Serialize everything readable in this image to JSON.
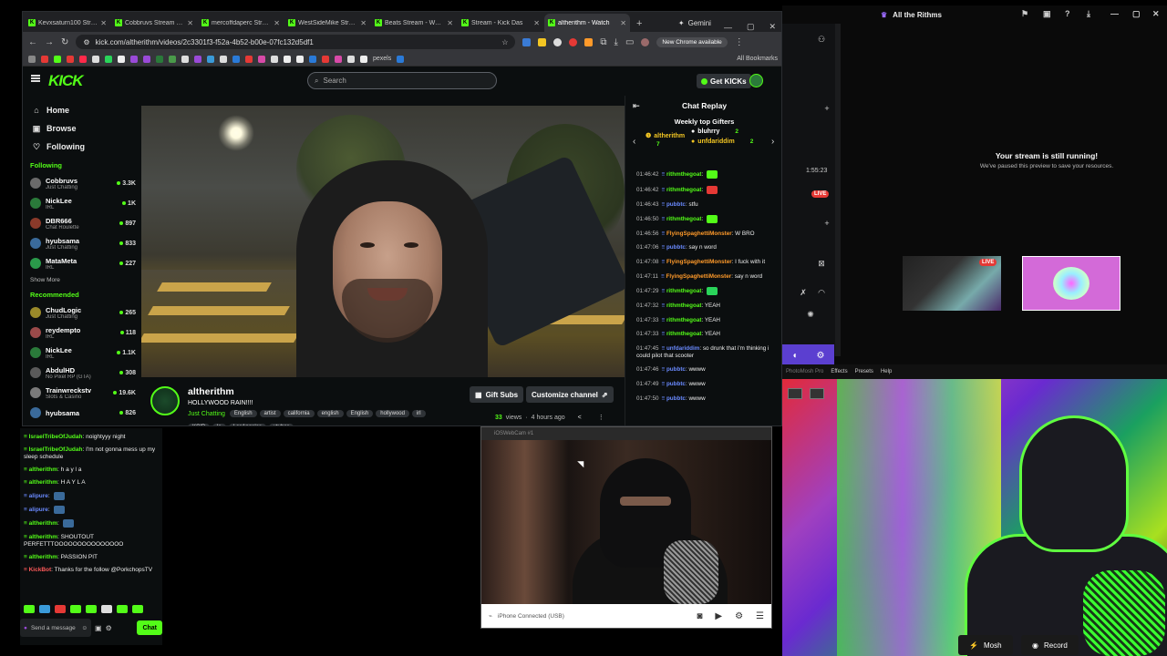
{
  "browser": {
    "tabs": [
      {
        "label": "Kevxsaturn100 Stream",
        "active": false
      },
      {
        "label": "Cobbruvs Stream - W",
        "active": false
      },
      {
        "label": "mercoffdaperc Stream",
        "active": false
      },
      {
        "label": "WestSideMike Stream",
        "active": false
      },
      {
        "label": "Beats Stream - Watch",
        "active": false
      },
      {
        "label": "Stream - Kick Das",
        "active": false
      },
      {
        "label": "altherithm - Watch",
        "active": true
      }
    ],
    "gemini_label": "Gemini",
    "url": "kick.com/altherithm/videos/2c3301f3-f52a-4b52-b00e-07fc132d5df1",
    "chrome_pill": "New Chrome available",
    "bookmark_pexels": "pexels",
    "all_bookmarks": "All Bookmarks"
  },
  "kick": {
    "logo": "KICK",
    "search_placeholder": "Search",
    "get_kicks": "Get KICKs",
    "nav": [
      {
        "label": "Home",
        "icon": "⌂"
      },
      {
        "label": "Browse",
        "icon": "▣"
      },
      {
        "label": "Following",
        "icon": "♡"
      }
    ],
    "following_heading": "Following",
    "following": [
      {
        "name": "Cobbruvs",
        "category": "Just Chatting",
        "viewers": "3.3K",
        "color": "#6a6a6a"
      },
      {
        "name": "NickLee",
        "category": "IRL",
        "viewers": "1K",
        "color": "#2a7a3a"
      },
      {
        "name": "DBR666",
        "category": "Chat Roulette",
        "viewers": "897",
        "color": "#8a3a2a"
      },
      {
        "name": "hyubsama",
        "category": "Just Chatting",
        "viewers": "833",
        "color": "#3a6a9a"
      },
      {
        "name": "MataMeta",
        "category": "IRL",
        "viewers": "227",
        "color": "#2a9a4a"
      }
    ],
    "show_more": "Show More",
    "recommended_heading": "Recommended",
    "recommended": [
      {
        "name": "ChudLogic",
        "category": "Just Chatting",
        "viewers": "265",
        "color": "#9a8a2a"
      },
      {
        "name": "reydempto",
        "category": "IRL",
        "viewers": "118",
        "color": "#9a4a4a"
      },
      {
        "name": "NickLee",
        "category": "IRL",
        "viewers": "1.1K",
        "color": "#2a7a3a"
      },
      {
        "name": "AbdulHD",
        "category": "No Pixel RP (GTA)",
        "viewers": "308",
        "color": "#5a5a5a"
      },
      {
        "name": "Trainwreckstv",
        "category": "Slots & Casino",
        "viewers": "19.6K",
        "color": "#7a7a7a"
      },
      {
        "name": "hyubsama",
        "category": "",
        "viewers": "826",
        "color": "#3a6a9a"
      }
    ],
    "stream": {
      "streamer": "altherithm",
      "title": "HOLLYWOOD RAIN!!!!",
      "category": "Just Chatting",
      "tags_row1": [
        "English",
        "artist",
        "california",
        "english",
        "English",
        "hollywood",
        "irl"
      ],
      "tags_row2": [
        "KCIP",
        "la",
        "LosAngeles",
        "vtuber"
      ],
      "gift_subs": "Gift Subs",
      "customize": "Customize channel",
      "views_count": "33",
      "views_label": "views",
      "time_ago": "4 hours ago"
    },
    "chat": {
      "title": "Chat Replay",
      "gifters_title": "Weekly top Gifters",
      "gifters": [
        {
          "name": "altherithm",
          "count": "7",
          "color": "#f3c623"
        },
        {
          "name": "bluhrry",
          "count": "2",
          "color": "#ffffff"
        },
        {
          "name": "unfdariddim",
          "count": "2",
          "color": "#f3c623"
        }
      ],
      "messages": [
        {
          "ts": "01:46:42",
          "user": "rithmthegoat",
          "color": "#53fc18",
          "text": ""
        },
        {
          "ts": "01:46:42",
          "user": "rithmthegoat",
          "color": "#53fc18",
          "text": ""
        },
        {
          "ts": "01:46:43",
          "user": "pubbtc",
          "color": "#6a8aff",
          "text": "stfu"
        },
        {
          "ts": "01:46:50",
          "user": "rithmthegoat",
          "color": "#53fc18",
          "text": ""
        },
        {
          "ts": "01:46:56",
          "user": "FlyingSpaghettiMonster",
          "color": "#ff9a2a",
          "text": "W BRO"
        },
        {
          "ts": "01:47:06",
          "user": "pubbtc",
          "color": "#6a8aff",
          "text": "say n word"
        },
        {
          "ts": "01:47:08",
          "user": "FlyingSpaghettiMonster",
          "color": "#ff9a2a",
          "text": "I fuck with it"
        },
        {
          "ts": "01:47:11",
          "user": "FlyingSpaghettiMonster",
          "color": "#ff9a2a",
          "text": "say n word"
        },
        {
          "ts": "01:47:29",
          "user": "rithmthegoat",
          "color": "#53fc18",
          "text": ""
        },
        {
          "ts": "01:47:32",
          "user": "rithmthegoat",
          "color": "#53fc18",
          "text": "YEAH"
        },
        {
          "ts": "01:47:33",
          "user": "rithmthegoat",
          "color": "#53fc18",
          "text": "YEAH"
        },
        {
          "ts": "01:47:33",
          "user": "rithmthegoat",
          "color": "#53fc18",
          "text": "YEAH"
        },
        {
          "ts": "01:47:45",
          "user": "unfdariddim",
          "color": "#6a8aff",
          "text": "so drunk that i'm thinking i could pilot that scooter"
        },
        {
          "ts": "01:47:46",
          "user": "pubbtc",
          "color": "#6a8aff",
          "text": "wwww"
        },
        {
          "ts": "01:47:49",
          "user": "pubbtc",
          "color": "#6a8aff",
          "text": "wwww"
        },
        {
          "ts": "01:47:50",
          "user": "pubbtc",
          "color": "#6a8aff",
          "text": "wwww"
        }
      ]
    }
  },
  "left_chat": {
    "messages": [
      {
        "user": "IsraelTribeOfJudah",
        "color": "#53fc18",
        "text": "noightyyy night"
      },
      {
        "user": "IsraelTribeOfJudah",
        "color": "#53fc18",
        "text": "I'm not gonna mess up my sleep schedule"
      },
      {
        "user": "altherithm",
        "color": "#53fc18",
        "text": "h a y l a"
      },
      {
        "user": "altherithm",
        "color": "#53fc18",
        "text": "H A Y L A"
      },
      {
        "user": "alipure",
        "color": "#6a8aff",
        "text": ""
      },
      {
        "user": "alipure",
        "color": "#6a8aff",
        "text": ""
      },
      {
        "user": "altherithm",
        "color": "#53fc18",
        "text": ""
      },
      {
        "user": "altherithm",
        "color": "#53fc18",
        "text": "SHOUTOUT PERFETTTOOOOOOOOOOOOOOO"
      },
      {
        "user": "altherithm",
        "color": "#53fc18",
        "text": "PASSION PIT"
      },
      {
        "user": "KickBot",
        "color": "#ff5a5a",
        "text": "Thanks for the follow @PorkchopsTV"
      }
    ],
    "send_placeholder": "Send a message",
    "chat_button": "Chat"
  },
  "rithms_panel": {
    "title": "All the Rithms",
    "timer": "1:55:23",
    "live": "LIVE",
    "running_title": "Your stream is still running!",
    "running_sub": "We've paused this preview to save your resources.",
    "thumb_live": "LIVE"
  },
  "mosh_app": {
    "menu": [
      "Effects",
      "Presets",
      "Help"
    ],
    "app_name": "PhotoMosh Pro",
    "mosh_button": "Mosh",
    "record_button": "Record"
  },
  "webcam": {
    "title": "iOSWebCam #1",
    "status": "iPhone Connected (USB)"
  }
}
